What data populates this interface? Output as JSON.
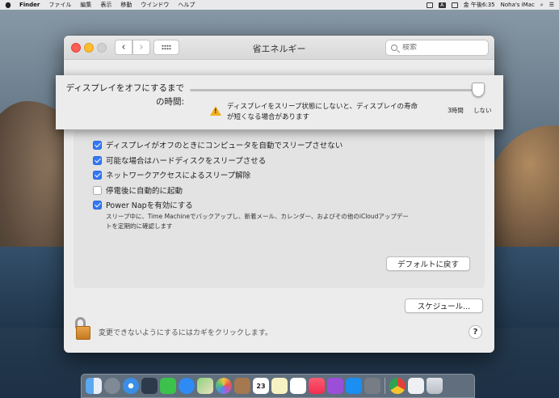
{
  "menubar": {
    "app_name": "Finder",
    "items": [
      "ファイル",
      "編集",
      "表示",
      "移動",
      "ウインドウ",
      "ヘルプ"
    ],
    "input_indicator": "A",
    "clock": "金 午後6:35",
    "user": "Noha's iMac"
  },
  "window": {
    "title": "省エネルギー",
    "search_placeholder": "検索"
  },
  "display_off": {
    "label_line1": "ディスプレイをオフにするまで",
    "label_line2": "の時間:",
    "slider_value": "しない",
    "tick_3h": "3時間",
    "tick_never": "しない",
    "warning_line1": "ディスプレイをスリープ状態にしないと、ディスプレイの寿命",
    "warning_line2": "が短くなる場合があります"
  },
  "options": [
    {
      "label": "ディスプレイがオフのときにコンピュータを自動でスリープさせない",
      "checked": true
    },
    {
      "label": "可能な場合はハードディスクをスリープさせる",
      "checked": true
    },
    {
      "label": "ネットワークアクセスによるスリープ解除",
      "checked": true
    },
    {
      "label": "停電後に自動的に起動",
      "checked": false
    },
    {
      "label": "Power Napを有効にする",
      "checked": true
    }
  ],
  "power_nap_desc_line1": "スリープ中に、Time Machineでバックアップし、新着メール、カレンダー、およびその他のiCloudアップデー",
  "power_nap_desc_line2": "トを定期的に確認します",
  "buttons": {
    "restore_defaults": "デフォルトに戻す",
    "schedule": "スケジュール..."
  },
  "lock_text": "変更できないようにするにはカギをクリックします。",
  "help_label": "?",
  "dock_icons": [
    "finder-icon",
    "launchpad-icon",
    "safari-icon",
    "photo-booth-icon",
    "facetime-icon",
    "messages-icon",
    "maps-icon",
    "photos-icon",
    "contacts-icon",
    "calendar-icon",
    "notes-icon",
    "reminders-icon",
    "music-icon",
    "podcasts-icon",
    "app-store-icon",
    "system-preferences-icon",
    "chrome-icon",
    "document-icon",
    "trash-icon"
  ],
  "dock_calendar_day": "23"
}
